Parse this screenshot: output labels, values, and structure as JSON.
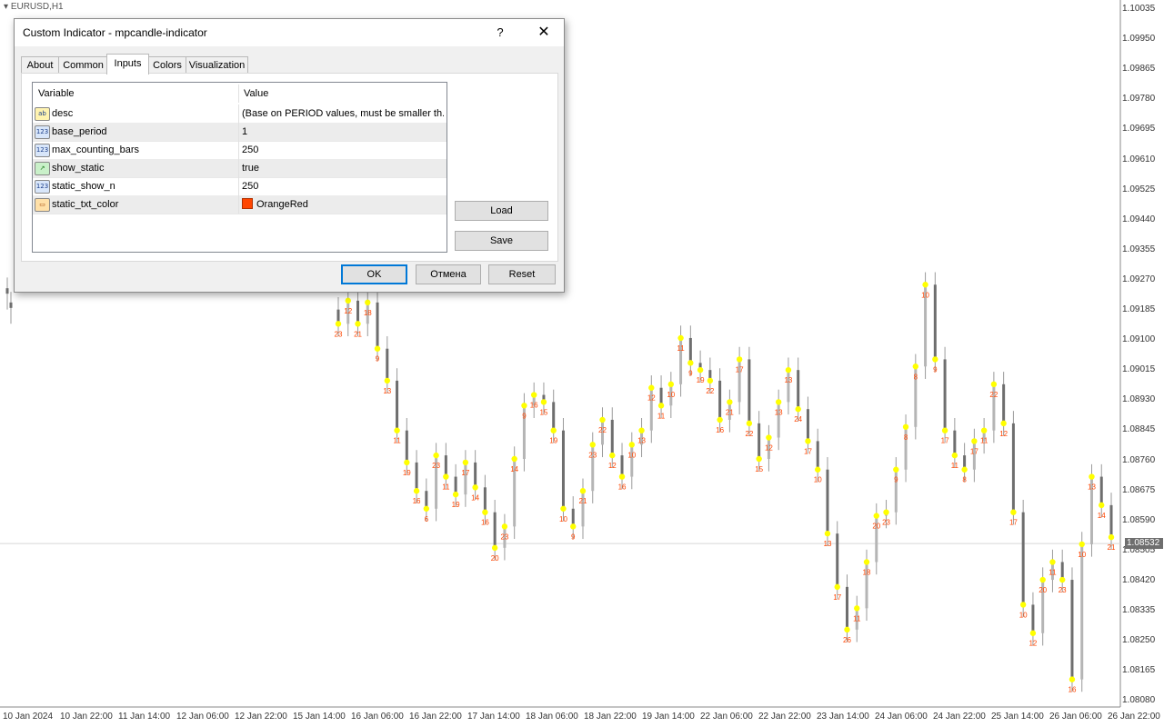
{
  "chart": {
    "symbol": "EURUSD,H1",
    "current_price": "1.08532",
    "price_labels": [
      "1.10035",
      "1.09950",
      "1.09865",
      "1.09780",
      "1.09695",
      "1.09610",
      "1.09525",
      "1.09440",
      "1.09355",
      "1.09270",
      "1.09185",
      "1.09100",
      "1.09015",
      "1.08930",
      "1.08845",
      "1.08760",
      "1.08675",
      "1.08590",
      "1.08505",
      "1.08420",
      "1.08335",
      "1.08250",
      "1.08165",
      "1.08080"
    ],
    "time_labels": [
      "10 Jan 2024",
      "10 Jan 22:00",
      "11 Jan 14:00",
      "12 Jan 06:00",
      "12 Jan 22:00",
      "15 Jan 14:00",
      "16 Jan 06:00",
      "16 Jan 22:00",
      "17 Jan 14:00",
      "18 Jan 06:00",
      "18 Jan 22:00",
      "19 Jan 14:00",
      "22 Jan 06:00",
      "22 Jan 22:00",
      "23 Jan 14:00",
      "24 Jan 06:00",
      "24 Jan 22:00",
      "25 Jan 14:00",
      "26 Jan 06:00",
      "26 Jan 22:00"
    ],
    "colors": {
      "bull": "#b5b5b5",
      "bear": "#6e6e6e",
      "marker": "#ffff00",
      "count_text": "#ff4500",
      "grid_line": "#d8d8d8"
    }
  },
  "chart_data": {
    "type": "candlestick",
    "price_range": [
      1.0808,
      1.10035
    ],
    "closes": [
      1.0915,
      1.09215,
      1.0915,
      1.0921,
      1.0908,
      1.0899,
      1.0885,
      1.0876,
      1.0868,
      1.0863,
      1.0878,
      1.0872,
      1.0867,
      1.0876,
      1.0869,
      1.0862,
      1.0852,
      1.0858,
      1.0877,
      1.0892,
      1.0895,
      1.0893,
      1.0885,
      1.0863,
      1.0858,
      1.0868,
      1.0881,
      1.0888,
      1.0878,
      1.0872,
      1.0881,
      1.0885,
      1.0897,
      1.0892,
      1.0898,
      1.0911,
      1.0904,
      1.0902,
      1.0899,
      1.0888,
      1.0893,
      1.0905,
      1.0887,
      1.0877,
      1.0883,
      1.0893,
      1.0902,
      1.0891,
      1.0882,
      1.0874,
      1.0856,
      1.0841,
      1.0829,
      1.0835,
      1.0848,
      1.0861,
      1.0862,
      1.0874,
      1.0886,
      1.0903,
      1.0926,
      1.0905,
      1.0885,
      1.0878,
      1.0874,
      1.0882,
      1.0885,
      1.0898,
      1.0887,
      1.0862,
      1.0836,
      1.0828,
      1.0843,
      1.0848,
      1.0843,
      1.0815,
      1.0853,
      1.0872,
      1.0864,
      1.0855
    ],
    "count_labels": [
      "23",
      "12",
      "21",
      "18",
      "9",
      "13",
      "11",
      "19",
      "16",
      "6",
      "23",
      "11",
      "19",
      "17",
      "14",
      "16",
      "20",
      "23",
      "14",
      "9",
      "16",
      "15",
      "19",
      "10",
      "9",
      "21",
      "23",
      "22",
      "12",
      "16",
      "10",
      "13",
      "12",
      "11",
      "10",
      "11",
      "9",
      "19",
      "22",
      "16",
      "21",
      "17",
      "22",
      "15",
      "12",
      "13",
      "13",
      "24",
      "17",
      "10",
      "13",
      "17",
      "26",
      "11",
      "18",
      "20",
      "23",
      "9",
      "8",
      "8",
      "10",
      "9",
      "17",
      "11",
      "8",
      "17",
      "11",
      "22",
      "12",
      "17",
      "10",
      "12",
      "20",
      "11",
      "23",
      "16",
      "10",
      "13",
      "14",
      "21"
    ]
  },
  "dialog": {
    "title": "Custom Indicator - mpcandle-indicator",
    "help": "?",
    "close": "✕",
    "tabs": [
      "About",
      "Common",
      "Inputs",
      "Colors",
      "Visualization"
    ],
    "active_tab": "Inputs",
    "columns": {
      "variable": "Variable",
      "value": "Value"
    },
    "params": [
      {
        "icon": "ab",
        "type": "string-icon",
        "name": "desc",
        "value": "(Base on PERIOD values, must be smaller th..."
      },
      {
        "icon": "123",
        "type": "integer-icon",
        "name": "base_period",
        "value": "1"
      },
      {
        "icon": "123",
        "type": "integer-icon",
        "name": "max_counting_bars",
        "value": "250"
      },
      {
        "icon": "↗",
        "type": "bool-icon",
        "name": "show_static",
        "value": "true"
      },
      {
        "icon": "123",
        "type": "integer-icon",
        "name": "static_show_n",
        "value": "250"
      },
      {
        "icon": "▭",
        "type": "color-icon",
        "name": "static_txt_color",
        "value": "OrangeRed",
        "swatch": "#ff4500"
      }
    ],
    "buttons": {
      "load": "Load",
      "save": "Save",
      "ok": "OK",
      "cancel": "Отмена",
      "reset": "Reset"
    }
  }
}
